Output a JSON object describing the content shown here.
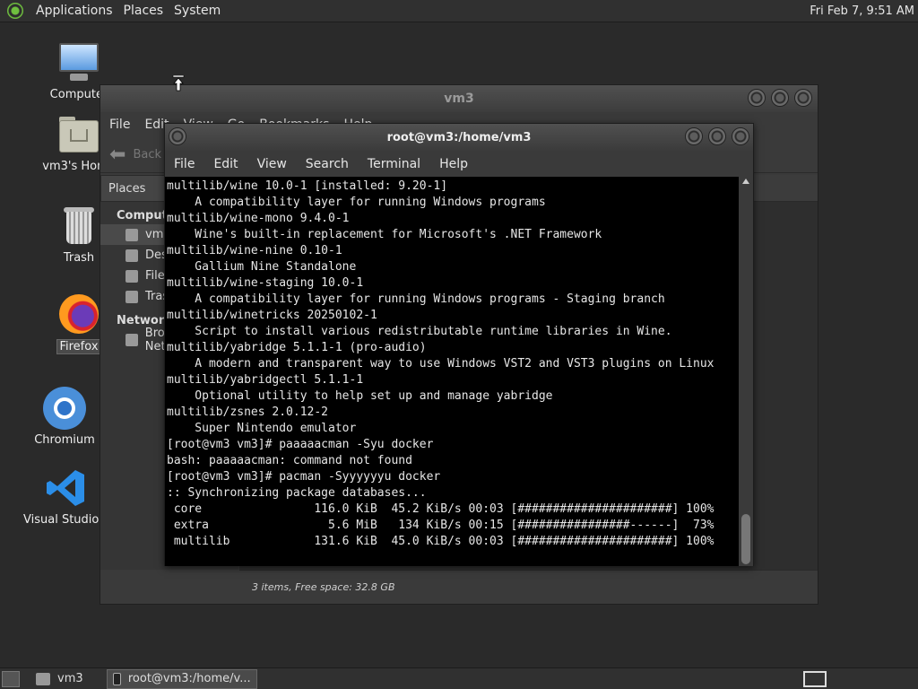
{
  "top_panel": {
    "menus": [
      "Applications",
      "Places",
      "System"
    ],
    "clock": "Fri Feb  7,  9:51 AM"
  },
  "desktop_icons": [
    {
      "label": "Computer",
      "icon": "computer-icon"
    },
    {
      "label": "vm3's Home",
      "icon": "home-folder-icon"
    },
    {
      "label": "Trash",
      "icon": "trash-icon"
    },
    {
      "label": "Firefox",
      "icon": "firefox-icon"
    },
    {
      "label": "Chromium",
      "icon": "chromium-icon"
    },
    {
      "label": "Visual Studio Code",
      "icon": "vscode-icon"
    }
  ],
  "file_manager": {
    "title": "vm3",
    "menus": [
      "File",
      "Edit",
      "View",
      "Go",
      "Bookmarks",
      "Help"
    ],
    "back_label": "Back",
    "sidebar_header": "Places",
    "sections": [
      {
        "name": "Computer",
        "items": [
          "vm3",
          "Desktop",
          "File System",
          "Trash"
        ]
      },
      {
        "name": "Network",
        "items": [
          "Browse Network"
        ]
      }
    ],
    "status": "3 items, Free space: 32.8 GB"
  },
  "terminal": {
    "title": "root@vm3:/home/vm3",
    "menus": [
      "File",
      "Edit",
      "View",
      "Search",
      "Terminal",
      "Help"
    ],
    "lines": [
      "multilib/wine 10.0-1 [installed: 9.20-1]",
      "    A compatibility layer for running Windows programs",
      "multilib/wine-mono 9.4.0-1",
      "    Wine's built-in replacement for Microsoft's .NET Framework",
      "multilib/wine-nine 0.10-1",
      "    Gallium Nine Standalone",
      "multilib/wine-staging 10.0-1",
      "    A compatibility layer for running Windows programs - Staging branch",
      "multilib/winetricks 20250102-1",
      "    Script to install various redistributable runtime libraries in Wine.",
      "multilib/yabridge 5.1.1-1 (pro-audio)",
      "    A modern and transparent way to use Windows VST2 and VST3 plugins on Linux",
      "multilib/yabridgectl 5.1.1-1",
      "    Optional utility to help set up and manage yabridge",
      "multilib/zsnes 2.0.12-2",
      "    Super Nintendo emulator",
      "[root@vm3 vm3]# paaaaacman -Syu docker",
      "bash: paaaaacman: command not found",
      "[root@vm3 vm3]# pacman -Syyyyyyu docker",
      ":: Synchronizing package databases...",
      " core                116.0 KiB  45.2 KiB/s 00:03 [######################] 100%",
      " extra                 5.6 MiB   134 KiB/s 00:15 [################------]  73%",
      " multilib            131.6 KiB  45.0 KiB/s 00:03 [######################] 100%"
    ]
  },
  "taskbar": {
    "tasks": [
      "vm3",
      "root@vm3:/home/v..."
    ]
  }
}
